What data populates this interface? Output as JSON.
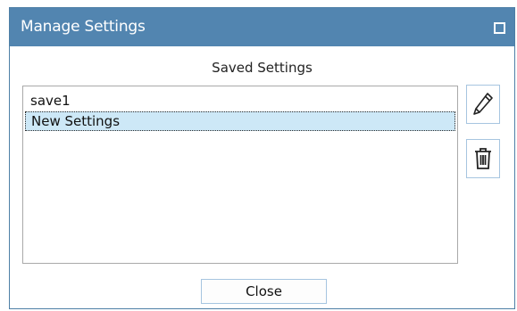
{
  "window": {
    "title": "Manage Settings"
  },
  "section": {
    "title": "Saved Settings"
  },
  "saved_settings": {
    "items": [
      {
        "label": "save1",
        "selected": false
      },
      {
        "label": "New Settings",
        "selected": true
      }
    ]
  },
  "actions": {
    "edit_icon": "pencil-icon",
    "delete_icon": "trash-icon",
    "close_label": "Close"
  },
  "colors": {
    "titlebar": "#5285b0",
    "selection": "#cde8f7",
    "button_border": "#a6c5e0"
  }
}
